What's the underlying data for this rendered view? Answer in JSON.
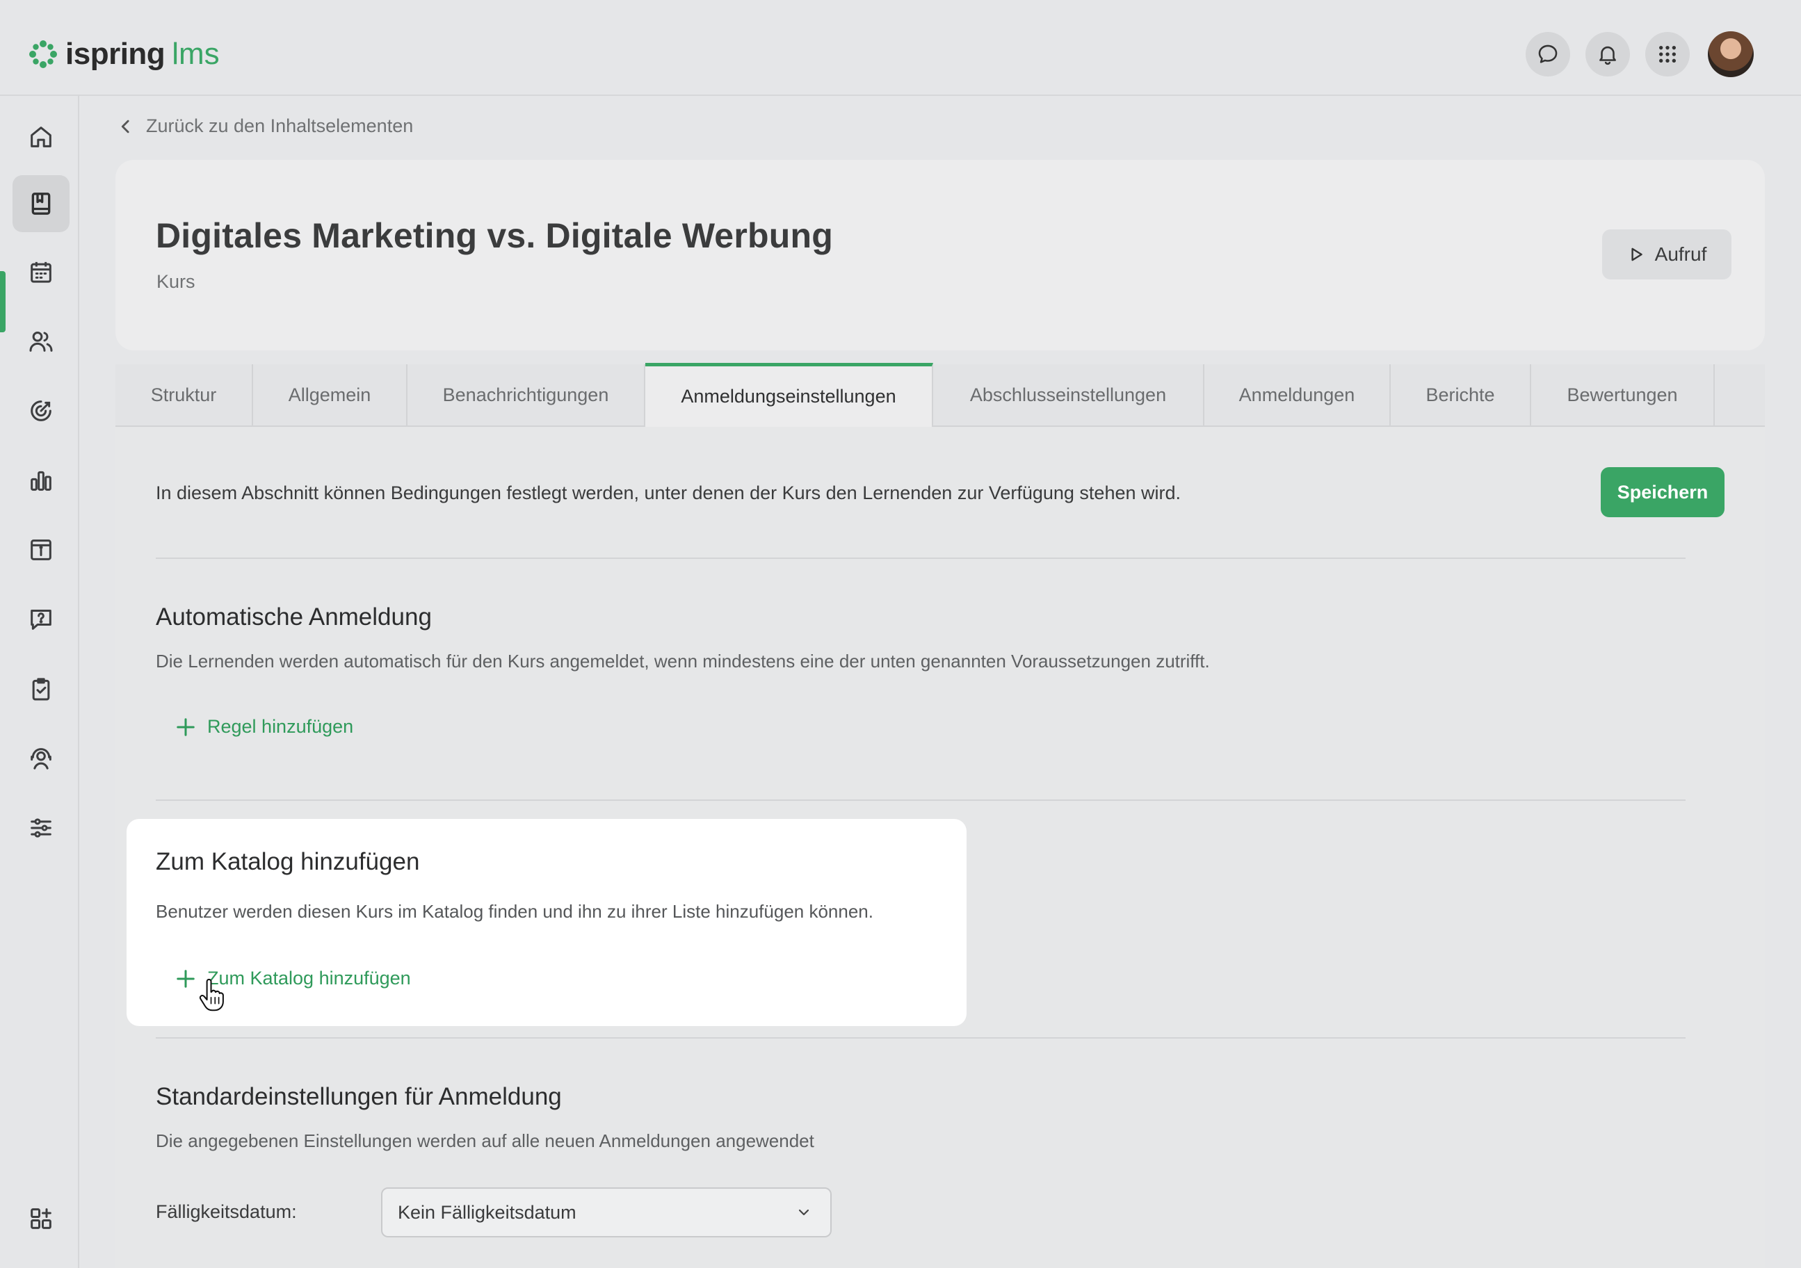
{
  "app": {
    "logo_main": "ispring",
    "logo_sub": "lms",
    "accent_color": "#3aa565"
  },
  "topbar": {
    "icons": [
      "chat-icon",
      "bell-icon",
      "apps-grid-icon",
      "user-avatar"
    ]
  },
  "sidebar": {
    "items": [
      {
        "icon": "home-icon",
        "active": false
      },
      {
        "icon": "book-icon",
        "active": true
      },
      {
        "icon": "calendar-icon",
        "active": false
      },
      {
        "icon": "users-icon",
        "active": false
      },
      {
        "icon": "target-icon",
        "active": false
      },
      {
        "icon": "bar-chart-icon",
        "active": false
      },
      {
        "icon": "info-calendar-icon",
        "active": false
      },
      {
        "icon": "question-chat-icon",
        "active": false
      },
      {
        "icon": "clipboard-check-icon",
        "active": false
      },
      {
        "icon": "support-agent-icon",
        "active": false
      },
      {
        "icon": "sliders-icon",
        "active": false
      }
    ],
    "bottom_icon": "add-widget-icon"
  },
  "breadcrumb": {
    "back_label": "Zurück zu den Inhaltselementen"
  },
  "course": {
    "title": "Digitales Marketing vs. Digitale Werbung",
    "type": "Kurs",
    "launch_label": "Aufruf"
  },
  "tabs": [
    {
      "label": "Struktur",
      "active": false
    },
    {
      "label": "Allgemein",
      "active": false
    },
    {
      "label": "Benachrichtigungen",
      "active": false
    },
    {
      "label": "Anmeldungseinstellungen",
      "active": true
    },
    {
      "label": "Abschlusseinstellungen",
      "active": false
    },
    {
      "label": "Anmeldungen",
      "active": false
    },
    {
      "label": "Berichte",
      "active": false
    },
    {
      "label": "Bewertungen",
      "active": false
    }
  ],
  "content": {
    "intro": "In diesem Abschnitt können Bedingungen festlegt werden, unter denen der Kurs den Lernenden zur Verfügung stehen wird.",
    "save_label": "Speichern",
    "auto_enrollment": {
      "title": "Automatische Anmeldung",
      "description": "Die Lernenden werden automatisch für den Kurs angemeldet, wenn mindestens eine der unten genannten Voraussetzungen zutrifft.",
      "add_label": "Regel hinzufügen"
    },
    "catalog": {
      "title": "Zum Katalog hinzufügen",
      "description": "Benutzer werden diesen Kurs im Katalog finden und ihn zu ihrer Liste hinzufügen können.",
      "add_label": "Zum Katalog hinzufügen"
    },
    "defaults": {
      "title": "Standardeinstellungen für Anmeldung",
      "description": "Die angegebenen Einstellungen werden auf alle neuen Anmeldungen angewendet",
      "due_label": "Fälligkeitsdatum:",
      "due_value": "Kein Fälligkeitsdatum"
    }
  }
}
